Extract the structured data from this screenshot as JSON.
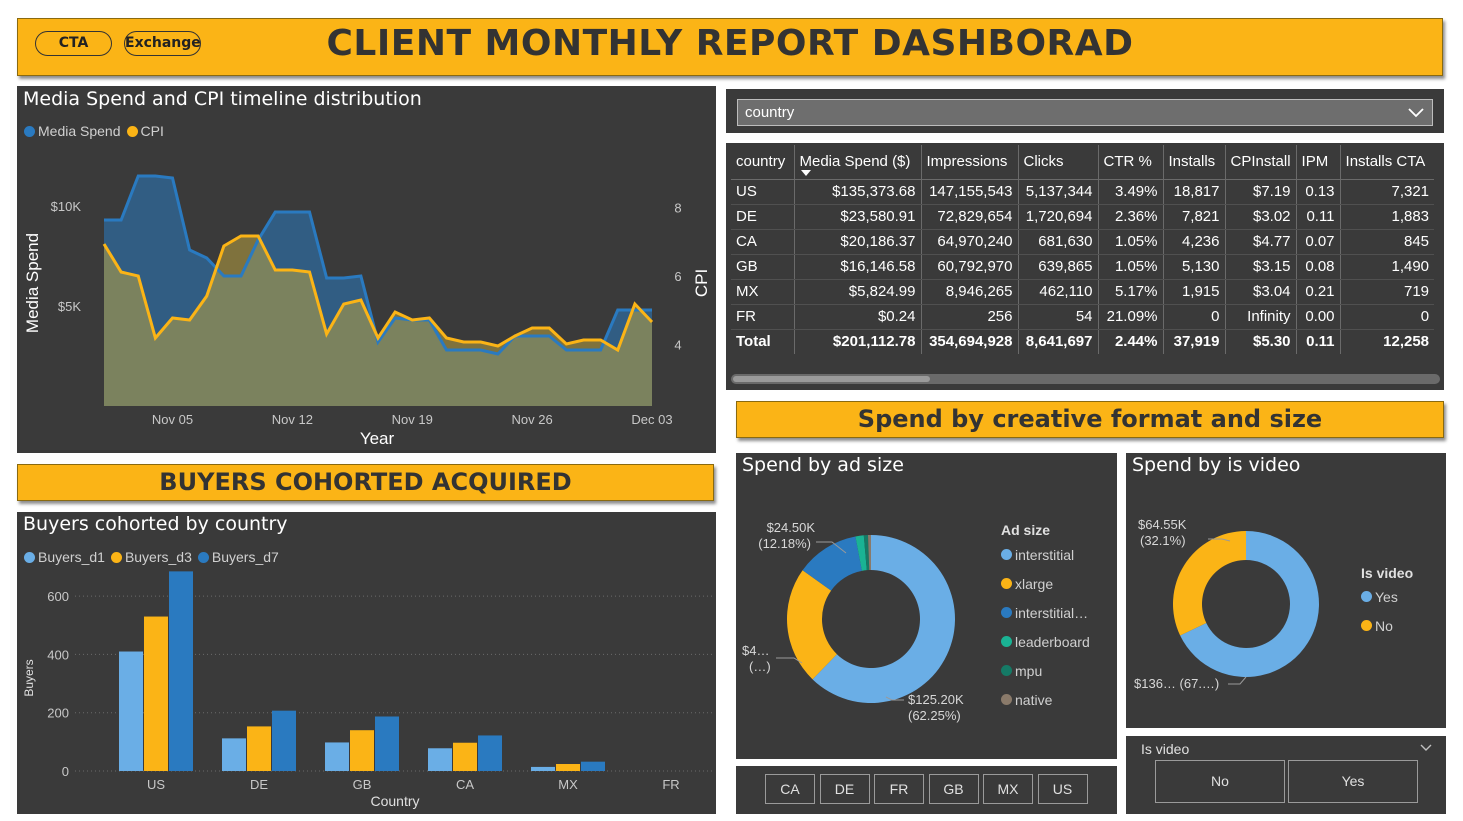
{
  "header": {
    "title": "CLIENT MONTHLY REPORT DASHBORAD",
    "buttons": [
      "CTA",
      "Exchange"
    ]
  },
  "colors": {
    "accent": "#fbb416",
    "panel": "#3a3a3a",
    "blue": "#2a7ac0",
    "light_blue": "#6aaee6",
    "yellow": "#fbb416",
    "teal": "#1ab394",
    "dark_teal": "#157a66",
    "brown": "#8a7a6a"
  },
  "timeline": {
    "title": "Media Spend and CPI timeline distribution",
    "legend": [
      {
        "name": "Media Spend",
        "color": "#2a7ac0"
      },
      {
        "name": "CPI",
        "color": "#fbb416"
      }
    ],
    "chart_data": {
      "type": "area",
      "title": "Media Spend and CPI timeline distribution",
      "xlabel": "Year",
      "ylabel": "Media Spend",
      "y2label": "CPI",
      "x_ticks": [
        "Nov 05",
        "Nov 12",
        "Nov 19",
        "Nov 26",
        "Dec 03"
      ],
      "y_ticks": [
        "$5K",
        "$10K"
      ],
      "y2_ticks": [
        "4",
        "6",
        "8"
      ],
      "ylim": [
        0,
        13000
      ],
      "y2lim": [
        2.2,
        9.8
      ],
      "x": [
        "Nov 01",
        "Nov 02",
        "Nov 03",
        "Nov 04",
        "Nov 05",
        "Nov 06",
        "Nov 07",
        "Nov 08",
        "Nov 09",
        "Nov 10",
        "Nov 11",
        "Nov 12",
        "Nov 13",
        "Nov 14",
        "Nov 15",
        "Nov 16",
        "Nov 17",
        "Nov 18",
        "Nov 19",
        "Nov 20",
        "Nov 21",
        "Nov 22",
        "Nov 23",
        "Nov 24",
        "Nov 25",
        "Nov 26",
        "Nov 27",
        "Nov 28",
        "Nov 29",
        "Nov 30",
        "Dec 01",
        "Dec 02",
        "Dec 03"
      ],
      "series": [
        {
          "name": "Media Spend",
          "axis": "left",
          "values": [
            9300,
            9300,
            11500,
            11500,
            11400,
            7800,
            7400,
            6500,
            6500,
            8300,
            9700,
            9700,
            9700,
            6400,
            6400,
            6500,
            3200,
            4400,
            4300,
            4300,
            2800,
            2800,
            2800,
            2600,
            3500,
            3500,
            3500,
            2800,
            2800,
            2800,
            4800,
            4800,
            4800
          ]
        },
        {
          "name": "CPI",
          "axis": "left",
          "values": [
            8100,
            6700,
            6500,
            3400,
            4400,
            4300,
            5500,
            8000,
            8500,
            8500,
            6800,
            6800,
            6700,
            3600,
            5100,
            5300,
            3400,
            4700,
            4300,
            4400,
            3400,
            3200,
            3200,
            3000,
            3500,
            3900,
            3900,
            3100,
            3300,
            3300,
            2800,
            5100,
            4200
          ]
        }
      ]
    }
  },
  "country_slicer": {
    "value": "country"
  },
  "table": {
    "columns": [
      "country",
      "Media Spend ($)",
      "Impressions",
      "Clicks",
      "CTR %",
      "Installs",
      "CPInstall",
      "IPM",
      "Installs CTA"
    ],
    "rows": [
      [
        "US",
        "$135,373.68",
        "147,155,543",
        "5,137,344",
        "3.49%",
        "18,817",
        "$7.19",
        "0.13",
        "7,321"
      ],
      [
        "DE",
        "$23,580.91",
        "72,829,654",
        "1,720,694",
        "2.36%",
        "7,821",
        "$3.02",
        "0.11",
        "1,883"
      ],
      [
        "CA",
        "$20,186.37",
        "64,970,240",
        "681,630",
        "1.05%",
        "4,236",
        "$4.77",
        "0.07",
        "845"
      ],
      [
        "GB",
        "$16,146.58",
        "60,792,970",
        "639,865",
        "1.05%",
        "5,130",
        "$3.15",
        "0.08",
        "1,490"
      ],
      [
        "MX",
        "$5,824.99",
        "8,946,265",
        "462,110",
        "5.17%",
        "1,915",
        "$3.04",
        "0.21",
        "719"
      ],
      [
        "FR",
        "$0.24",
        "256",
        "54",
        "21.09%",
        "0",
        "Infinity",
        "0.00",
        "0"
      ]
    ],
    "total": [
      "Total",
      "$201,112.78",
      "354,694,928",
      "8,641,697",
      "2.44%",
      "37,919",
      "$5.30",
      "0.11",
      "12,258"
    ]
  },
  "buyers_section_title": "BUYERS COHORTED ACQUIRED",
  "buyers": {
    "title": "Buyers cohorted by country",
    "legend": [
      {
        "name": "Buyers_d1",
        "color": "#6aaee6"
      },
      {
        "name": "Buyers_d3",
        "color": "#fbb416"
      },
      {
        "name": "Buyers_d7",
        "color": "#2a7ac0"
      }
    ],
    "chart_data": {
      "type": "bar",
      "title": "Buyers cohorted by country",
      "xlabel": "Country",
      "ylabel": "Buyers",
      "categories": [
        "US",
        "DE",
        "GB",
        "CA",
        "MX",
        "FR"
      ],
      "y_ticks": [
        "0",
        "200",
        "400",
        "600"
      ],
      "ylim": [
        0,
        700
      ],
      "series": [
        {
          "name": "Buyers_d1",
          "values": [
            410,
            112,
            98,
            78,
            14,
            0
          ]
        },
        {
          "name": "Buyers_d3",
          "values": [
            530,
            153,
            140,
            97,
            24,
            0
          ]
        },
        {
          "name": "Buyers_d7",
          "values": [
            685,
            207,
            187,
            122,
            32,
            0
          ]
        }
      ]
    }
  },
  "creative_section_title": "Spend by creative format and size",
  "ad_size": {
    "title": "Spend by ad size",
    "legend_title": "Ad size",
    "chart_data": {
      "type": "pie",
      "title": "Spend by ad size",
      "categories": [
        "interstitial",
        "xlarge",
        "interstitial…",
        "leaderboard",
        "mpu",
        "native"
      ],
      "values": [
        62.25,
        22.6,
        12.18,
        1.6,
        0.8,
        0.57
      ],
      "colors": [
        "#6aaee6",
        "#fbb416",
        "#2a7ac0",
        "#1ab394",
        "#157a66",
        "#8a7a6a"
      ]
    },
    "labels": {
      "top": [
        "$24.50K",
        "(12.18%)"
      ],
      "left": [
        "$4…",
        "(…)"
      ],
      "bottom": [
        "$125.20K",
        "(62.25%)"
      ]
    }
  },
  "is_video": {
    "title": "Spend by is video",
    "legend_title": "Is video",
    "chart_data": {
      "type": "pie",
      "title": "Spend by is video",
      "categories": [
        "Yes",
        "No"
      ],
      "values": [
        67.9,
        32.1
      ],
      "colors": [
        "#6aaee6",
        "#fbb416"
      ]
    },
    "labels": {
      "top": [
        "$64.55K",
        "(32.1%)"
      ],
      "bottom": [
        "$136… (67.…)"
      ]
    }
  },
  "country_buttons": [
    "CA",
    "DE",
    "FR",
    "GB",
    "MX",
    "US"
  ],
  "is_video_slicer": {
    "title": "Is video",
    "options": [
      "No",
      "Yes"
    ]
  }
}
